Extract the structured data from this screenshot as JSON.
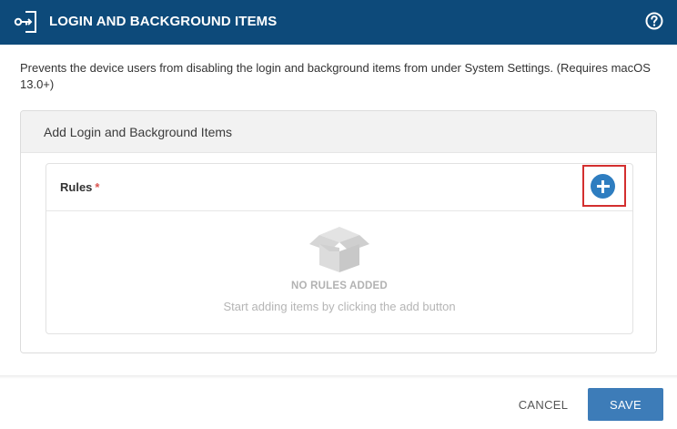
{
  "header": {
    "title": "LOGIN AND BACKGROUND ITEMS",
    "icon": "login-key-icon",
    "help_icon": "help-circle-icon",
    "background_color": "#0d4a7a"
  },
  "description": "Prevents the device users from disabling the login and background items from under System Settings. (Requires macOS 13.0+)",
  "section": {
    "title": "Add Login and Background Items",
    "rules": {
      "label": "Rules",
      "required_marker": "*",
      "add_icon": "plus-circle-icon",
      "empty_state": {
        "icon": "open-box-icon",
        "title": "NO RULES ADDED",
        "subtitle": "Start adding items by clicking the add button"
      }
    }
  },
  "footer": {
    "cancel_label": "CANCEL",
    "save_label": "SAVE",
    "accent_color": "#3d7cb8"
  }
}
